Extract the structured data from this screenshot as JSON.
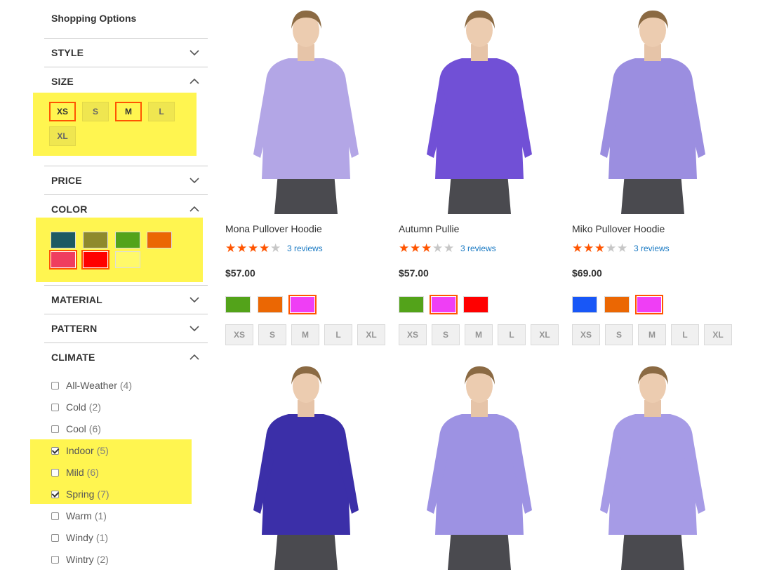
{
  "sidebar": {
    "title": "Shopping Options",
    "style_label": "STYLE",
    "size_label": "SIZE",
    "price_label": "PRICE",
    "color_label": "COLOR",
    "material_label": "MATERIAL",
    "pattern_label": "PATTERN",
    "climate_label": "CLIMATE",
    "sizes": [
      {
        "label": "XS",
        "selected": true
      },
      {
        "label": "S",
        "selected": false
      },
      {
        "label": "M",
        "selected": true
      },
      {
        "label": "L",
        "selected": false
      },
      {
        "label": "XL",
        "selected": false
      }
    ],
    "colors": [
      {
        "hex": "#1d5a63",
        "selected": false
      },
      {
        "hex": "#8e8a2c",
        "selected": false
      },
      {
        "hex": "#53a31a",
        "selected": false
      },
      {
        "hex": "#eb6703",
        "selected": false
      },
      {
        "hex": "#ef3e5f",
        "selected": true
      },
      {
        "hex": "#ff0000",
        "selected": true
      },
      {
        "hex": "#fff96a",
        "selected": false
      }
    ],
    "climate": [
      {
        "label": "All-Weather",
        "count": "(4)",
        "checked": false
      },
      {
        "label": "Cold",
        "count": "(2)",
        "checked": false
      },
      {
        "label": "Cool",
        "count": "(6)",
        "checked": false
      },
      {
        "label": "Indoor",
        "count": "(5)",
        "checked": true
      },
      {
        "label": "Mild",
        "count": "(6)",
        "checked": false
      },
      {
        "label": "Spring",
        "count": "(7)",
        "checked": true
      },
      {
        "label": "Warm",
        "count": "(1)",
        "checked": false
      },
      {
        "label": "Windy",
        "count": "(1)",
        "checked": false
      },
      {
        "label": "Wintry",
        "count": "(2)",
        "checked": false
      }
    ]
  },
  "products": [
    {
      "name": "Mona Pullover Hoodie",
      "rating": 4,
      "reviews": "3 reviews",
      "price": "$57.00",
      "colors": [
        {
          "hex": "#53a31a",
          "selected": false
        },
        {
          "hex": "#eb6703",
          "selected": false
        },
        {
          "hex": "#ef3ef5",
          "selected": true
        }
      ],
      "sizes": [
        "XS",
        "S",
        "M",
        "L",
        "XL"
      ],
      "garment_color": "#b3a6e6"
    },
    {
      "name": "Autumn Pullie",
      "rating": 3,
      "reviews": "3 reviews",
      "price": "$57.00",
      "colors": [
        {
          "hex": "#53a31a",
          "selected": false
        },
        {
          "hex": "#ef3ef5",
          "selected": true
        },
        {
          "hex": "#ff0000",
          "selected": false
        }
      ],
      "sizes": [
        "XS",
        "S",
        "M",
        "L",
        "XL"
      ],
      "garment_color": "#7150d6"
    },
    {
      "name": "Miko Pullover Hoodie",
      "rating": 3,
      "reviews": "3 reviews",
      "price": "$69.00",
      "colors": [
        {
          "hex": "#1857f7",
          "selected": false
        },
        {
          "hex": "#eb6703",
          "selected": false
        },
        {
          "hex": "#ef3ef5",
          "selected": true
        }
      ],
      "sizes": [
        "XS",
        "S",
        "M",
        "L",
        "XL"
      ],
      "garment_color": "#9b8ee0"
    },
    {
      "name": "",
      "garment_color": "#3b2fa8"
    },
    {
      "name": "",
      "garment_color": "#9d92e3"
    },
    {
      "name": "",
      "garment_color": "#a69be6"
    }
  ],
  "colors": {
    "accent": "#ff5501",
    "highlight": "#fff550",
    "link": "#1979c3"
  }
}
